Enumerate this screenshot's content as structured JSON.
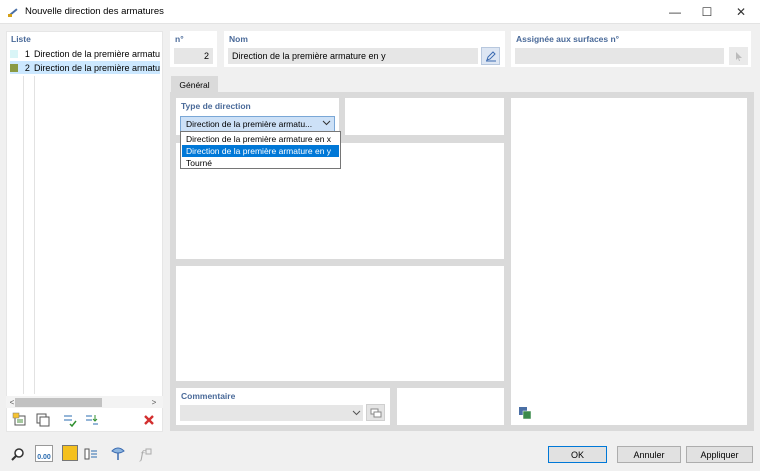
{
  "window": {
    "title": "Nouvelle direction des armatures",
    "min_glyph": "—",
    "max_glyph": "☐",
    "close_glyph": "✕"
  },
  "list": {
    "label": "Liste",
    "items": [
      {
        "num": "1",
        "name": "Direction de la première armatu",
        "color": "#d9f5f7"
      },
      {
        "num": "2",
        "name": "Direction de la première armatu",
        "color": "#8a9a44"
      }
    ],
    "scroll_left": "<",
    "scroll_right": ">"
  },
  "header": {
    "no_label": "n°",
    "no_value": "2",
    "name_label": "Nom",
    "name_value": "Direction de la première armature en y",
    "assigned_label": "Assignée aux surfaces n°",
    "assigned_value": ""
  },
  "tabs": [
    {
      "label": "Général"
    }
  ],
  "direction": {
    "label": "Type de direction",
    "selected": "Direction de la première armatu...",
    "options": [
      {
        "label": "Direction de la première armature en x"
      },
      {
        "label": "Direction de la première armature en y"
      },
      {
        "label": "Tourné"
      }
    ]
  },
  "comment": {
    "label": "Commentaire",
    "value": ""
  },
  "footer": {
    "ok": "OK",
    "cancel": "Annuler",
    "apply": "Appliquer",
    "units_value": "0.00"
  }
}
